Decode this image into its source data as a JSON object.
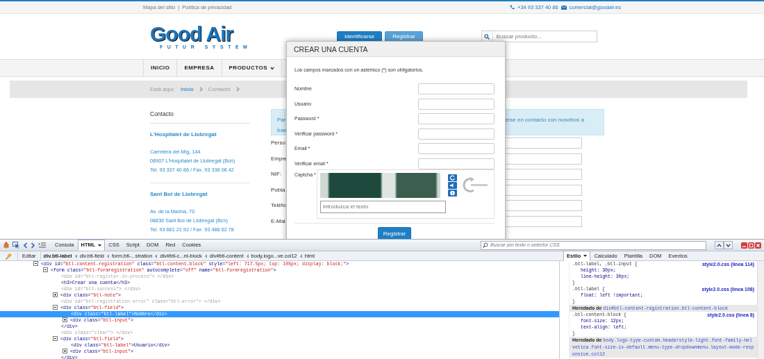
{
  "top_bar": {
    "links": [
      "Mapa del sitio",
      "Política de privacidad"
    ],
    "separator": "|",
    "phone": "+34 93 337 40 86",
    "email": "comercial@goodair.es"
  },
  "header": {
    "logo": {
      "title": "Good Air",
      "subtitle": "FUTUR SYSTEM"
    },
    "buttons": [
      {
        "label": "Identificarse",
        "kind": "primary"
      },
      {
        "label": "Registrar",
        "kind": "light"
      }
    ],
    "search": {
      "placeholder": "Buscar producto..."
    }
  },
  "nav": [
    {
      "label": "INICIO",
      "dropdown": false
    },
    {
      "label": "EMPRESA",
      "dropdown": false
    },
    {
      "label": "PRODUCTOS",
      "dropdown": true
    }
  ],
  "breadcrumb": {
    "prefix": "Está aquí:",
    "items": [
      {
        "label": "Inicio",
        "link": true
      },
      {
        "label": "Contacto",
        "link": false
      }
    ]
  },
  "contact": {
    "title": "Contacto",
    "offices": [
      {
        "name": "L'Hospitalet de Llobregat",
        "lines": [
          "Carretera del Mig, 144",
          "08907 L'Hospitalet de Llobregat (Bcn)",
          "Tel. 93 337 40 86 / Fax. 93 338 06 42"
        ]
      },
      {
        "name": "Sant Boi de Llobregat",
        "lines": [
          "Av. de la Marina, 70",
          "08830 Sant Boi de Llobregat (Bcn)",
          "Tel. 93 661 21 92 / Fax. 93 488 62 78"
        ]
      }
    ]
  },
  "notice": {
    "left_lines": [
      "Par",
      "trav"
    ],
    "right_text": "erse en contacto con nosotros a"
  },
  "form_fields": [
    "Perso",
    "Empre",
    "NIF:",
    "Pobla",
    "Teléfo",
    "E-Mai"
  ],
  "modal": {
    "title": "CREAR UNA CUENTA",
    "note": "Los campos marcados con un asterisco (*) son obligatorios.",
    "fields": [
      "Nombre",
      "Usuario",
      "Password *",
      "Verificar password *",
      "Email *",
      "Verificar email *"
    ],
    "captcha": {
      "label": "Captcha *",
      "placeholder": "Introduzca el texto"
    },
    "submit": "Registrar"
  },
  "devtools": {
    "tabs": [
      {
        "label": "Consola",
        "selected": false,
        "dropdown": false
      },
      {
        "label": "HTML",
        "selected": true,
        "dropdown": true
      },
      {
        "label": "CSS",
        "selected": false,
        "dropdown": false
      },
      {
        "label": "Script",
        "selected": false,
        "dropdown": false
      },
      {
        "label": "DOM",
        "selected": false,
        "dropdown": false
      },
      {
        "label": "Red",
        "selected": false,
        "dropdown": false
      },
      {
        "label": "Cookies",
        "selected": false,
        "dropdown": false
      }
    ],
    "search": {
      "placeholder": "Buscar por texto o selector CSS"
    },
    "edit_button": "Editar",
    "breadcrumbs": [
      {
        "label": "div.btl-label",
        "selected": true
      },
      {
        "label": "div.btl-field",
        "selected": false
      },
      {
        "label": "form.btl-...stration",
        "selected": false
      },
      {
        "label": "div#btl-c...nt-block",
        "selected": false
      },
      {
        "label": "div#btl-content",
        "selected": false
      },
      {
        "label": "body.logo...ve.col12",
        "selected": false
      },
      {
        "label": "html",
        "selected": false
      }
    ],
    "html_tree": [
      {
        "text": "<div id=\"btl-content-registration\" class=\"btl-content-block\" style=\"left: 717.5px; top: 105px; display: block;\">",
        "expanded": true,
        "selected": false,
        "dimmed": false,
        "children": [
          {
            "text": "<form class=\"btl-formregistration\" autocomplete=\"off\" name=\"btl-formregistration\">",
            "expanded": true,
            "selected": false,
            "dimmed": false,
            "children": [
              {
                "text": "<div id=\"btl-register-in-process\"> </div>",
                "selected": false,
                "dimmed": true
              },
              {
                "text": "<h3>Crear una cuenta</h3>",
                "selected": false,
                "dimmed": false
              },
              {
                "text": "<div id=\"btl-success\"> </div>",
                "selected": false,
                "dimmed": true
              },
              {
                "text": "<div class=\"btl-note\">",
                "expanded": false,
                "selected": false,
                "dimmed": false
              },
              {
                "text": "<div id=\"btl-registration-error\" class=\"btl-error\"> </div>",
                "selected": false,
                "dimmed": true
              },
              {
                "text": "<div class=\"btl-field\">",
                "expanded": true,
                "selected": false,
                "dimmed": false,
                "closing": "</div>",
                "children": [
                  {
                    "text": "<div class=\"btl-label\">Nombre</div>",
                    "selected": true,
                    "dimmed": false
                  },
                  {
                    "text": "<div class=\"btl-input\">",
                    "expanded": false,
                    "selected": false,
                    "dimmed": false
                  }
                ]
              },
              {
                "text": "<div class=\"clear\"> </div>",
                "selected": false,
                "dimmed": true
              },
              {
                "text": "<div class=\"btl-field\">",
                "expanded": true,
                "selected": false,
                "dimmed": false,
                "closing": "</div>",
                "children": [
                  {
                    "text": "<div class=\"btl-label\">Usuario</div>",
                    "selected": false,
                    "dimmed": false
                  },
                  {
                    "text": "<div class=\"btl-input\">",
                    "expanded": false,
                    "selected": false,
                    "dimmed": false
                  }
                ]
              }
            ]
          }
        ]
      }
    ],
    "side_tabs": [
      {
        "label": "Estilo",
        "selected": true,
        "dropdown": true
      },
      {
        "label": "Calculado",
        "selected": false,
        "dropdown": false
      },
      {
        "label": "Plantilla",
        "selected": false,
        "dropdown": false
      },
      {
        "label": "DOM",
        "selected": false,
        "dropdown": false
      },
      {
        "label": "Eventos",
        "selected": false,
        "dropdown": false
      }
    ],
    "style_rules": [
      {
        "kind": "rule",
        "selector": ".btl-label, .btl-input {",
        "source": "style2.0.css (línea 114)",
        "properties": [
          "height: 30px;",
          "line-height: 30px;"
        ],
        "close": "}"
      },
      {
        "kind": "rule",
        "selector": ".btl-label {",
        "source": "style2.0.css (línea 108)",
        "properties": [
          "float: left !important;"
        ],
        "close": "}"
      },
      {
        "kind": "inherited",
        "prefix": "Heredado de",
        "target": "div#btl-content-registration.btl-content-block"
      },
      {
        "kind": "rule",
        "selector": ".btl-content-block {",
        "source": "style2.0.css (línea 8)",
        "properties": [
          "font-size: 12px;",
          "text-align: left;"
        ],
        "close": "}"
      },
      {
        "kind": "inherited",
        "prefix": "Heredado de",
        "target": "body.logo-type-custom.headerstyle-light.font-family-helvetica.font-size-is-default.menu-type-dropdownmenu.layout-mode-responsive.col12"
      }
    ]
  }
}
